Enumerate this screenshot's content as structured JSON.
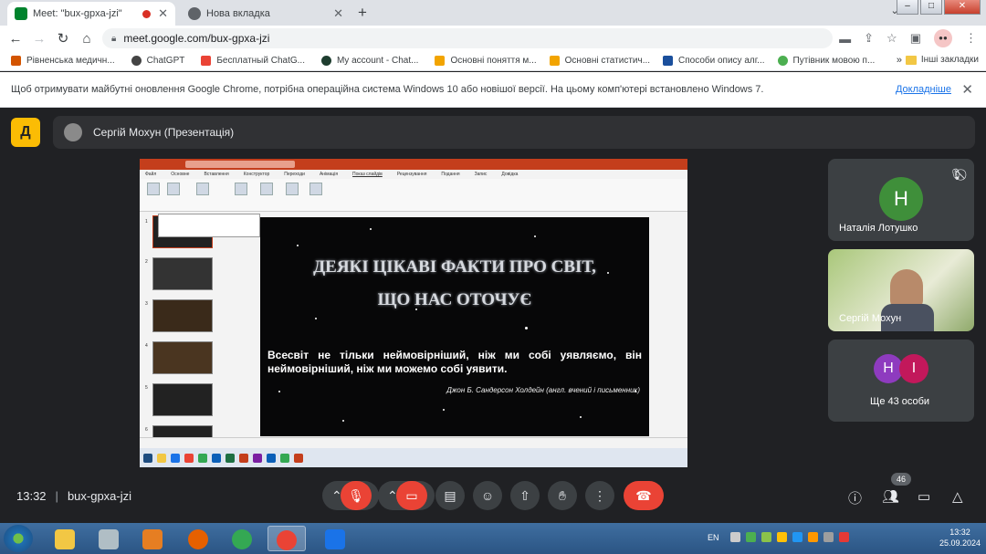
{
  "tabs": [
    {
      "title": "Meet: \"bux-gpxa-jzi\""
    },
    {
      "title": "Нова вкладка"
    }
  ],
  "address": {
    "url": "meet.google.com/bux-gpxa-jzi"
  },
  "bookmarks": {
    "items": [
      "Рівненська медичн...",
      "ChatGPT",
      "Бесплатный ChatG...",
      "My account - Chat...",
      "Основні поняття м...",
      "Основні статистич...",
      "Способи опису алг...",
      "Путівник мовою п..."
    ],
    "more": "»",
    "other": "Інші закладки"
  },
  "infobar": {
    "message": "Щоб отримувати майбутні оновлення Google Chrome, потрібна операційна система Windows 10 або новішої версії. На цьому комп'ютері встановлено Windows 7.",
    "link": "Докладніше"
  },
  "meet": {
    "logo": "Д",
    "presenter": "Сергій Мохун (Презентація)",
    "time": "13:32",
    "meeting_code": "bux-gpxa-jzi",
    "people_count": "46"
  },
  "powerpoint": {
    "menu": [
      "Файл",
      "Основне",
      "Вставлення",
      "Конструктор",
      "Переходи",
      "Анімація",
      "Показ слайдів",
      "Рецензування",
      "Подання",
      "Запис",
      "Довідка"
    ],
    "slide_numbers": [
      "1",
      "2",
      "3",
      "4",
      "5",
      "6"
    ]
  },
  "slide": {
    "title_line1": "ДЕЯКІ ЦІКАВІ ФАКТИ ПРО СВІТ,",
    "title_line2": "ЩО НАС ОТОЧУЄ",
    "quote": "Всесвіт не тільки неймовірніший, ніж ми собі уявляємо, він неймовірніший, ніж ми можемо собі уявити.",
    "author": "Джон Б. Сандерсон Холдейн (англ. вчений і письменник)"
  },
  "participants": [
    {
      "name": "Наталія Лотушко",
      "initial": "Н",
      "color": "#3f8f3a"
    },
    {
      "name": "Сергій Мохун"
    },
    {
      "name": "Ще 43 особи",
      "initials": [
        "Н",
        "І"
      ],
      "colors": [
        "#8e3bbf",
        "#c2185b"
      ]
    }
  ],
  "taskbar": {
    "lang": "EN",
    "time": "13:32",
    "date": "25.09.2024"
  }
}
